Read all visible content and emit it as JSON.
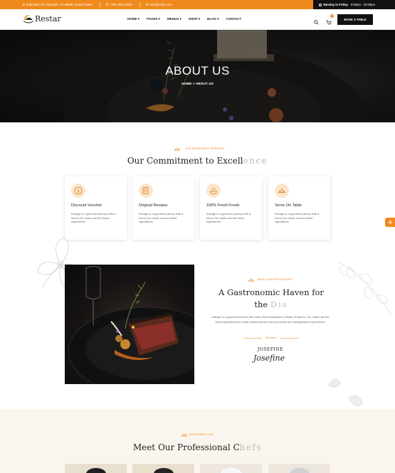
{
  "topbar": {
    "address": "9482 Main St, Plymouth, CA 95669, United States",
    "phone": "+987-628-10015",
    "email": "info@restar.com",
    "hours_label": "Monday to Friday",
    "hours_value": "9:00am - 22:00pm"
  },
  "nav": {
    "logo": "Restar",
    "menu": [
      "HOME",
      "PAGES",
      "MENUS",
      "SHOP",
      "BLOG",
      "CONTACT"
    ],
    "cart_count": "0",
    "book_button": "BOOK A TABLE"
  },
  "hero": {
    "title": "ABOUT US",
    "breadcrumb_home": "HOME",
    "breadcrumb_sep": ">",
    "breadcrumb_current": "ABOUT US"
  },
  "services": {
    "eyebrow": "OUR RESTAURANT SERVICES",
    "title_main": "Our Commitment to Excell",
    "title_fade": "ence",
    "cards": [
      {
        "title": "Discount Voucher",
        "text": "Indulge in a gourmet journey with a menu Our chefs use the finest ingredients.",
        "icon": "voucher-icon"
      },
      {
        "title": "Original Recipes",
        "text": "Indulge in a gourmet journey with a menu Our chefs use the finest ingredients.",
        "icon": "recipe-icon"
      },
      {
        "title": "100% Fresh Foods",
        "text": "Indulge in a gourmet journey with a menu Our chefs use the finest ingredients.",
        "icon": "fresh-food-icon"
      },
      {
        "title": "Serve On Table",
        "text": "Indulge in a gourmet journey with a menu Our chefs use the finest ingredients.",
        "icon": "serving-icon"
      }
    ]
  },
  "about": {
    "eyebrow": "ABOUT OUR RESTAURANT",
    "title_line1": "A Gastronomic Haven for",
    "title_line2_main": "the ",
    "title_line2_fade": "Dis",
    "text": "Indulge in a gourmet journey with menu that showcases a fusion of flavors. Our chefs use the finest ingredients to create dishes that are not just meals but unforgettable experiences.",
    "divider_mark": "♦♦♦♦♦♦",
    "signer": "JOSEFINE",
    "signature": "Josefine"
  },
  "chefs": {
    "eyebrow": "OUR EXPERT CHEF",
    "title_main": "Meet Our Professional C",
    "title_fade": "hefs"
  },
  "colors": {
    "accent": "#f08a1c",
    "dark": "#111111"
  }
}
